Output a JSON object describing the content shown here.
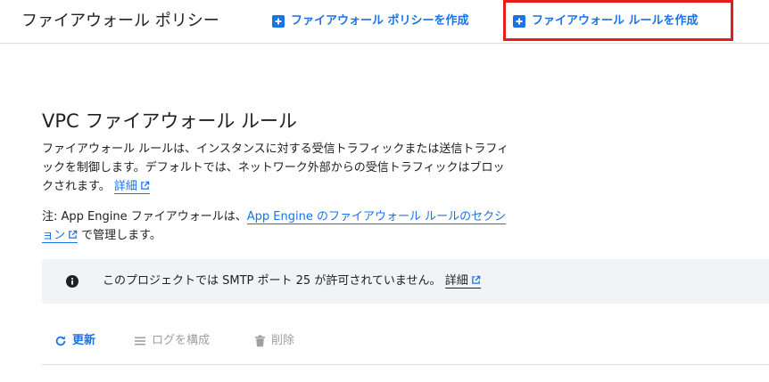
{
  "header": {
    "title": "ファイアウォール ポリシー",
    "create_policy_label": "ファイアウォール ポリシーを作成",
    "create_rule_label": "ファイアウォール ルールを作成"
  },
  "main": {
    "section_title": "VPC ファイアウォール ルール",
    "description": "ファイアウォール ルールは、インスタンスに対する受信トラフィックまたは送信トラフィックを制御します。デフォルトでは、ネットワーク外部からの受信トラフィックはブロックされます。",
    "details_link": "詳細",
    "note_prefix": "注: App Engine ファイアウォールは、",
    "note_link": "App Engine のファイアウォール ルールのセクション",
    "note_suffix": " で管理します。"
  },
  "banner": {
    "text": "このプロジェクトでは SMTP ポート 25 が許可されていません。",
    "link": "詳細"
  },
  "toolbar": {
    "refresh_label": "更新",
    "log_label": "ログを構成",
    "delete_label": "削除"
  },
  "colors": {
    "accent": "#1a73e8",
    "highlight": "#e0201f",
    "banner_bg": "#f1f3f4",
    "disabled": "#9aa0a6"
  },
  "icons": {
    "create_policy": "add-box-icon",
    "create_rule": "add-box-icon",
    "external": "external-link-icon",
    "info": "info-icon",
    "refresh": "refresh-icon",
    "log": "list-icon",
    "delete": "trash-icon"
  }
}
